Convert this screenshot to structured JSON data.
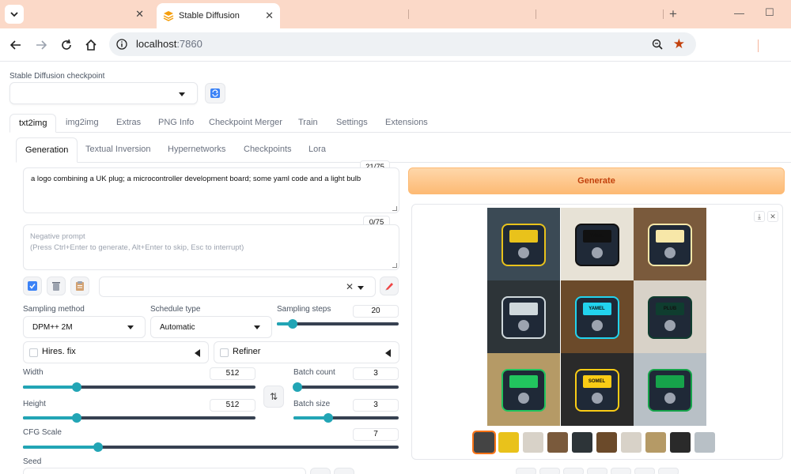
{
  "browser": {
    "tabs": [
      {
        "label": ""
      },
      {
        "label": "Stable Diffusion"
      }
    ],
    "url": "localhost:7860",
    "url_host": "localhost",
    "url_port": ":7860"
  },
  "checkpoint": {
    "label": "Stable Diffusion checkpoint",
    "value": ""
  },
  "main_tabs": [
    "txt2img",
    "img2img",
    "Extras",
    "PNG Info",
    "Checkpoint Merger",
    "Train",
    "Settings",
    "Extensions"
  ],
  "sub_tabs": [
    "Generation",
    "Textual Inversion",
    "Hypernetworks",
    "Checkpoints",
    "Lora"
  ],
  "prompt": {
    "text": "a logo combining a UK plug; a microcontroller development board; some yaml code and a light bulb",
    "token_count": "21/75"
  },
  "negative_prompt": {
    "placeholder_line1": "Negative prompt",
    "placeholder_line2": "(Press Ctrl+Enter to generate, Alt+Enter to skip, Esc to interrupt)",
    "token_count": "0/75"
  },
  "sampling": {
    "method_label": "Sampling method",
    "method_value": "DPM++ 2M",
    "schedule_label": "Schedule type",
    "schedule_value": "Automatic",
    "steps_label": "Sampling steps",
    "steps_value": "20",
    "steps_fraction": 0.13
  },
  "hires_fix": {
    "label": "Hires. fix"
  },
  "refiner": {
    "label": "Refiner"
  },
  "width": {
    "label": "Width",
    "value": "512",
    "fraction": 0.23
  },
  "height": {
    "label": "Height",
    "value": "512",
    "fraction": 0.23
  },
  "batch_count": {
    "label": "Batch count",
    "value": "3",
    "fraction": 0.04
  },
  "batch_size": {
    "label": "Batch size",
    "value": "3",
    "fraction": 0.33
  },
  "cfg_scale": {
    "label": "CFG Scale",
    "value": "7",
    "fraction": 0.2
  },
  "seed": {
    "label": "Seed"
  },
  "generate": {
    "label": "Generate"
  },
  "colors": {
    "accent": "#22a5b5",
    "generate_bg": "#fdba74",
    "generate_text": "#c2410c",
    "tabbar": "#fbd9c8"
  },
  "gallery": {
    "cells": [
      {
        "bg": "#3b4a55",
        "fg": "#e9c21b",
        "text": ""
      },
      {
        "bg": "#e7e2d6",
        "fg": "#111",
        "text": "YAML"
      },
      {
        "bg": "#7a5a3c",
        "fg": "#f7e7a8",
        "text": ""
      },
      {
        "bg": "#2d3438",
        "fg": "#cfd8dc",
        "text": ""
      },
      {
        "bg": "#6b4a2a",
        "fg": "#22d3ee",
        "text": "YAMEL"
      },
      {
        "bg": "#d8d2c8",
        "fg": "#0f3d2f",
        "text": "PLUB"
      },
      {
        "bg": "#b59a66",
        "fg": "#22c55e",
        "text": ""
      },
      {
        "bg": "#2a2a2a",
        "fg": "#facc15",
        "text": "SOMEL CODE"
      },
      {
        "bg": "#b8c0c6",
        "fg": "#16a34a",
        "text": ""
      }
    ],
    "thumb_count": 10
  }
}
